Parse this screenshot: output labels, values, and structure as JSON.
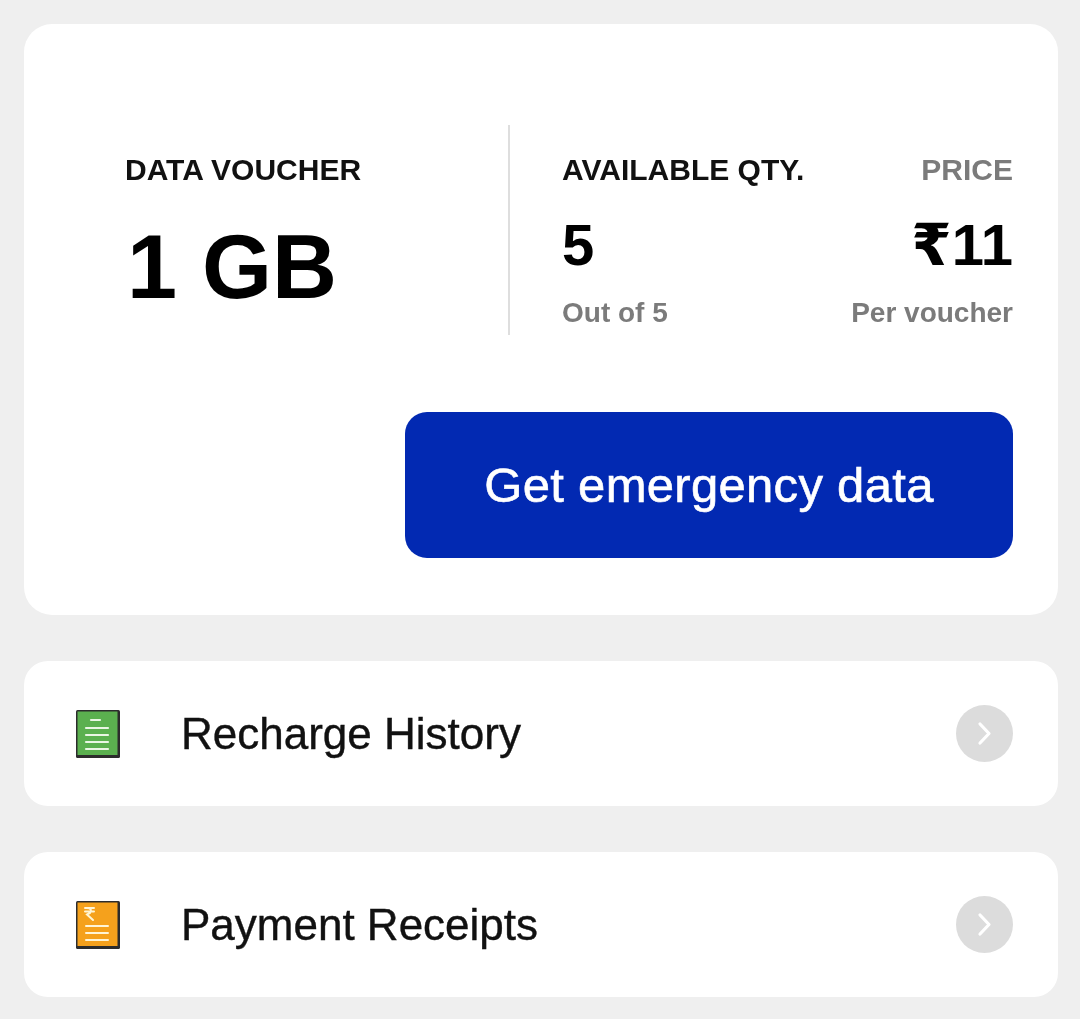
{
  "voucher": {
    "label": "DATA VOUCHER",
    "value": "1 GB"
  },
  "quantity": {
    "label": "AVAILABLE QTY.",
    "value": "5",
    "note": "Out of 5"
  },
  "price": {
    "label": "PRICE",
    "value": "₹11",
    "note": "Per voucher"
  },
  "action_button": {
    "label": "Get emergency data"
  },
  "menu_items": [
    {
      "kind": "history",
      "label": "Recharge History",
      "color": "#5bb04f"
    },
    {
      "kind": "receipt",
      "label": "Payment Receipts",
      "color": "#f5a11c"
    }
  ]
}
